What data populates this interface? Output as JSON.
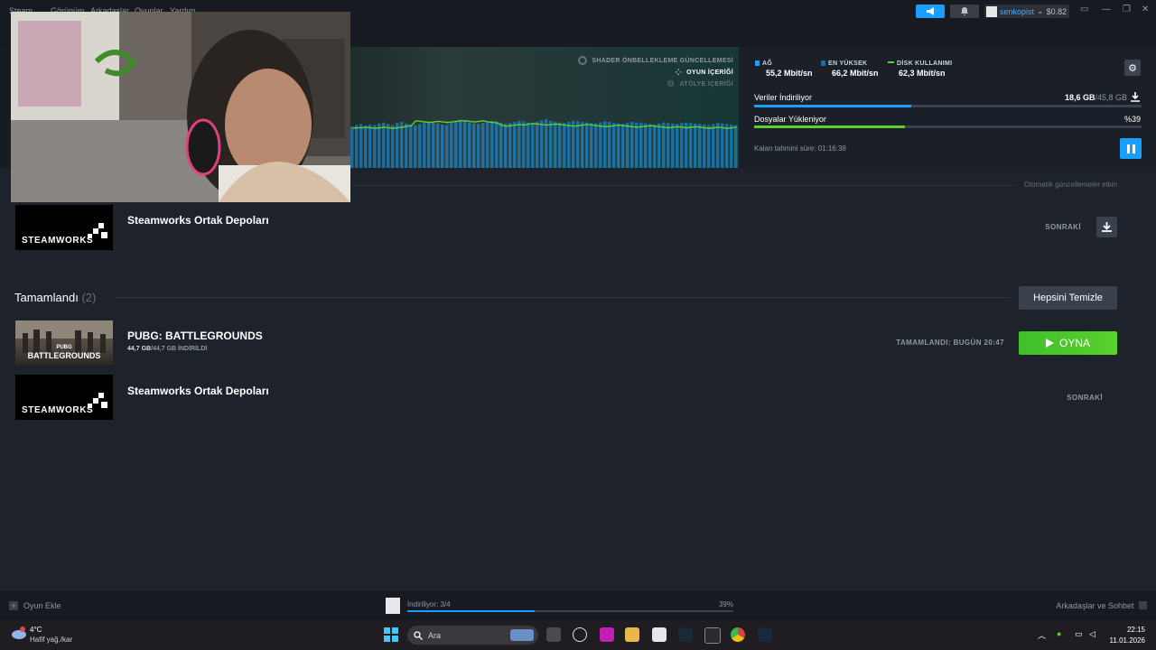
{
  "menu": [
    "Steam",
    "Görünüm",
    "Arkadaşlar",
    "Oyunlar",
    "Yardım"
  ],
  "account": {
    "username": "senkopist",
    "balance": "$0.82"
  },
  "content_types": [
    {
      "label": "SHADER ÖNBELLEKLEME GÜNCELLEMESİ",
      "color": "#67707b"
    },
    {
      "label": "OYUN İÇERİĞİ",
      "color": "#ffffff"
    },
    {
      "label": "ATÖLYE İÇERİĞİ",
      "color": "#67707b"
    }
  ],
  "stats": {
    "network": {
      "label": "AĞ",
      "value": "55,2 Mbit/sn",
      "color": "#1a9fff"
    },
    "peak": {
      "label": "EN YÜKSEK",
      "value": "66,2 Mbit/sn",
      "color": "#1a9fff"
    },
    "disk": {
      "label": "DİSK KULLANIMI",
      "value": "62,3 Mbit/sn",
      "color": "#5ad12c"
    }
  },
  "progress": {
    "download": {
      "label": "Veriler İndiriliyor",
      "done": "18,6 GB",
      "total": "/45,8 GB",
      "fraction": 0.406,
      "color": "#1a9fff"
    },
    "install": {
      "label": "Dosyalar Yükleniyor",
      "percent_text": "%39",
      "fraction": 0.39,
      "color": "#5ad12c"
    }
  },
  "eta": "Kalan tahmini süre: 01:16:38",
  "auto_updates": "Otomatik güncellemeler etkin",
  "up_next": {
    "title": "Steamworks Ortak Depoları",
    "thumb_text": "STEAMWORKS",
    "status": "SONRAKİ"
  },
  "completed": {
    "title": "Tamamlandı",
    "count": "(2)",
    "clear_label": "Hepsini Temizle",
    "items": [
      {
        "title": "PUBG: BATTLEGROUNDS",
        "size_done": "44,7 GB",
        "size_total": "/44,7 GB İNDİRİLDİ",
        "status": "TAMAMLANDI: BUGÜN 20:47",
        "play_label": "OYNA",
        "thumb_text": "BATTLEGROUNDS",
        "thumb_sub": "PUBG"
      },
      {
        "title": "Steamworks Ortak Depoları",
        "thumb_text": "STEAMWORKS",
        "status": "SONRAKİ"
      }
    ]
  },
  "footer": {
    "add_game": "Oyun Ekle",
    "downloading": "İndiriliyor: 3/4",
    "percent": "39%",
    "fraction": 0.39,
    "friends": "Arkadaşlar ve Sohbet"
  },
  "taskbar": {
    "temp": "4°C",
    "weather": "Hafif yağ./kar",
    "search_placeholder": "Ara",
    "time": "22:15",
    "date": "11.01.2026"
  },
  "graph": {
    "bars": [
      0.78,
      0.8,
      0.82,
      0.79,
      0.81,
      0.8,
      0.83,
      0.85,
      0.82,
      0.8,
      0.84,
      0.86,
      0.83,
      0.81,
      0.8,
      0.82,
      0.84,
      0.86,
      0.85,
      0.83,
      0.81,
      0.8,
      0.84,
      0.88,
      0.9,
      0.87,
      0.85,
      0.83,
      0.82,
      0.84,
      0.86,
      0.88,
      0.87,
      0.85,
      0.83,
      0.84,
      0.86,
      0.88,
      0.87,
      0.85,
      0.84,
      0.86,
      0.89,
      0.91,
      0.88,
      0.86,
      0.85,
      0.84,
      0.86,
      0.88,
      0.87,
      0.86,
      0.85,
      0.84,
      0.83,
      0.85,
      0.87,
      0.86,
      0.84,
      0.83,
      0.82,
      0.84,
      0.86,
      0.85,
      0.84,
      0.83,
      0.82,
      0.81,
      0.83,
      0.85,
      0.84,
      0.83,
      0.82,
      0.84,
      0.85,
      0.84,
      0.83,
      0.82,
      0.81,
      0.8,
      0.82,
      0.84,
      0.83,
      0.82,
      0.81,
      0.8
    ],
    "disk_line": [
      0.74,
      0.75,
      0.75,
      0.76,
      0.75,
      0.74,
      0.75,
      0.76,
      0.75,
      0.74,
      0.75,
      0.76,
      0.78,
      0.79,
      0.88,
      0.87,
      0.86,
      0.85,
      0.86,
      0.87,
      0.86,
      0.85,
      0.86,
      0.87,
      0.88,
      0.88,
      0.87,
      0.86,
      0.87,
      0.88,
      0.86,
      0.85,
      0.84,
      0.8,
      0.78,
      0.79,
      0.8,
      0.81,
      0.8,
      0.82,
      0.83,
      0.82,
      0.81,
      0.8,
      0.81,
      0.82,
      0.81,
      0.8,
      0.79,
      0.78,
      0.79,
      0.8,
      0.81,
      0.8,
      0.79,
      0.78,
      0.77,
      0.78,
      0.79,
      0.8,
      0.79,
      0.78,
      0.77,
      0.76,
      0.77,
      0.78,
      0.79,
      0.78,
      0.77,
      0.76,
      0.75,
      0.76,
      0.77,
      0.76,
      0.75,
      0.76,
      0.77,
      0.76,
      0.75,
      0.74,
      0.75,
      0.76,
      0.75,
      0.74,
      0.75,
      0.76
    ]
  }
}
